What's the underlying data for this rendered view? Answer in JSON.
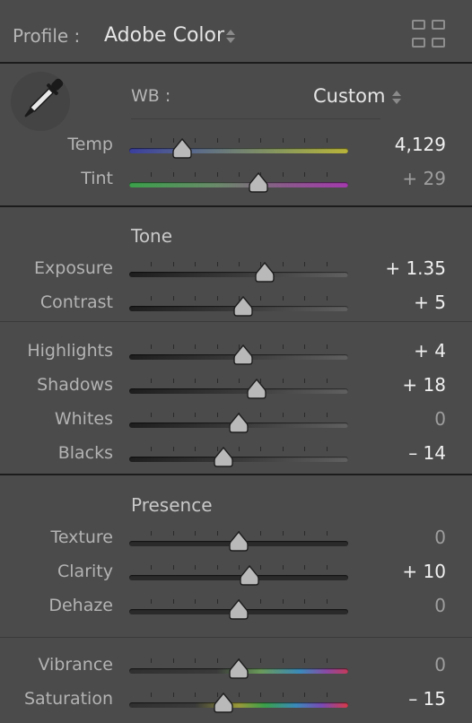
{
  "profile": {
    "label": "Profile :",
    "value": "Adobe Color",
    "icons": {
      "stepper": "up-down-arrows-icon",
      "browse": "grid-icon"
    }
  },
  "wb": {
    "label": "WB :",
    "value": "Custom",
    "tool_icon": "eyedropper-icon"
  },
  "colors": {
    "background": "#4b4b4b",
    "track": "#272727",
    "thumb": "#b9b9b9",
    "divider": "#1c1c1c"
  },
  "sliders": {
    "temp": {
      "label": "Temp",
      "value": "4,129",
      "position": 0.24,
      "bright": true,
      "gradient": "temp"
    },
    "tint": {
      "label": "Tint",
      "value": "+ 29",
      "position": 0.59,
      "bright": false,
      "gradient": "tint"
    },
    "exposure": {
      "label": "Exposure",
      "value": "+ 1.35",
      "position": 0.62,
      "bright": true,
      "gradient": "tone"
    },
    "contrast": {
      "label": "Contrast",
      "value": "+ 5",
      "position": 0.52,
      "bright": true,
      "gradient": "tone"
    },
    "highlights": {
      "label": "Highlights",
      "value": "+ 4",
      "position": 0.52,
      "bright": true,
      "gradient": "tone"
    },
    "shadows": {
      "label": "Shadows",
      "value": "+ 18",
      "position": 0.58,
      "bright": true,
      "gradient": "tone"
    },
    "whites": {
      "label": "Whites",
      "value": "0",
      "position": 0.5,
      "bright": false,
      "gradient": "tone"
    },
    "blacks": {
      "label": "Blacks",
      "value": "– 14",
      "position": 0.43,
      "bright": true,
      "gradient": "tone"
    },
    "texture": {
      "label": "Texture",
      "value": "0",
      "position": 0.5,
      "bright": false,
      "gradient": "flat"
    },
    "clarity": {
      "label": "Clarity",
      "value": "+ 10",
      "position": 0.55,
      "bright": true,
      "gradient": "flat"
    },
    "dehaze": {
      "label": "Dehaze",
      "value": "0",
      "position": 0.5,
      "bright": false,
      "gradient": "flat"
    },
    "vibrance": {
      "label": "Vibrance",
      "value": "0",
      "position": 0.5,
      "bright": false,
      "gradient": "vibrance"
    },
    "saturation": {
      "label": "Saturation",
      "value": "– 15",
      "position": 0.43,
      "bright": true,
      "gradient": "saturation"
    }
  },
  "sections": {
    "tone": "Tone",
    "presence": "Presence"
  }
}
